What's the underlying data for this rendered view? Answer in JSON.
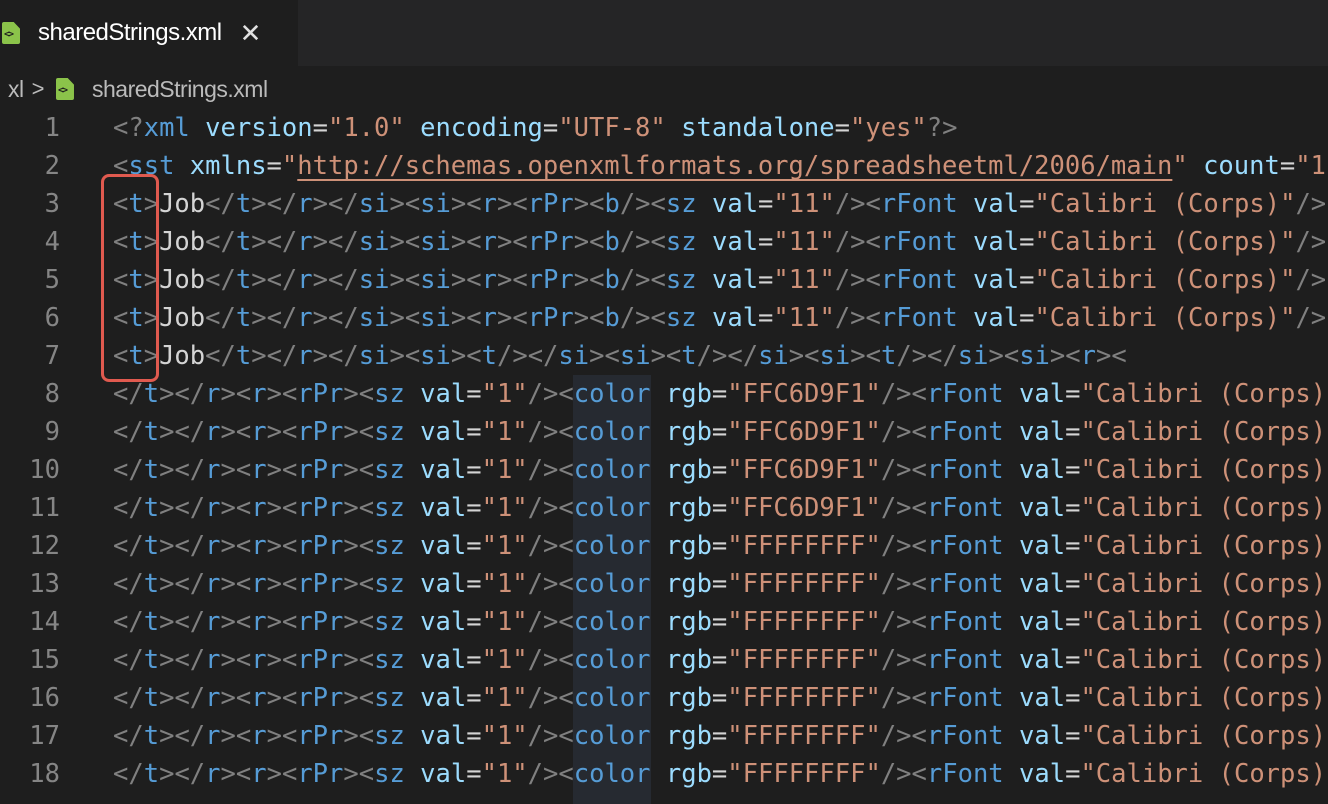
{
  "tab": {
    "label": "sharedStrings.xml",
    "close": "✕",
    "icon": "xml-file-icon",
    "icon_color": "#8bc34a"
  },
  "breadcrumb": {
    "folder": "xl",
    "separator": ">",
    "file": "sharedStrings.xml"
  },
  "highlight_color": "#e05a4f",
  "lines": [
    {
      "n": "1",
      "text": "<?xml version=\"1.0\" encoding=\"UTF-8\" standalone=\"yes\"?>"
    },
    {
      "n": "2",
      "text": "<sst xmlns=\"http://schemas.openxmlformats.org/spreadsheetml/2006/main\" count=\"1"
    },
    {
      "n": "3",
      "text": "<t>Job</t></r></si><si><r><rPr><b/><sz val=\"11\"/><rFont val=\"Calibri (Corps)\"/>"
    },
    {
      "n": "4",
      "text": "<t>Job</t></r></si><si><r><rPr><b/><sz val=\"11\"/><rFont val=\"Calibri (Corps)\"/>"
    },
    {
      "n": "5",
      "text": "<t>Job</t></r></si><si><r><rPr><b/><sz val=\"11\"/><rFont val=\"Calibri (Corps)\"/>"
    },
    {
      "n": "6",
      "text": "<t>Job</t></r></si><si><r><rPr><b/><sz val=\"11\"/><rFont val=\"Calibri (Corps)\"/>"
    },
    {
      "n": "7",
      "text": "<t>Job</t></r></si><si><t/></si><si><t/></si><si><t/></si><si><r><"
    },
    {
      "n": "8",
      "text": "</t></r><r><rPr><sz val=\"1\"/><color rgb=\"FFC6D9F1\"/><rFont val=\"Calibri (Corps)"
    },
    {
      "n": "9",
      "text": "</t></r><r><rPr><sz val=\"1\"/><color rgb=\"FFC6D9F1\"/><rFont val=\"Calibri (Corps)"
    },
    {
      "n": "10",
      "text": "</t></r><r><rPr><sz val=\"1\"/><color rgb=\"FFC6D9F1\"/><rFont val=\"Calibri (Corps)"
    },
    {
      "n": "11",
      "text": "</t></r><r><rPr><sz val=\"1\"/><color rgb=\"FFC6D9F1\"/><rFont val=\"Calibri (Corps)"
    },
    {
      "n": "12",
      "text": "</t></r><r><rPr><sz val=\"1\"/><color rgb=\"FFFFFFFF\"/><rFont val=\"Calibri (Corps)"
    },
    {
      "n": "13",
      "text": "</t></r><r><rPr><sz val=\"1\"/><color rgb=\"FFFFFFFF\"/><rFont val=\"Calibri (Corps)"
    },
    {
      "n": "14",
      "text": "</t></r><r><rPr><sz val=\"1\"/><color rgb=\"FFFFFFFF\"/><rFont val=\"Calibri (Corps)"
    },
    {
      "n": "15",
      "text": "</t></r><r><rPr><sz val=\"1\"/><color rgb=\"FFFFFFFF\"/><rFont val=\"Calibri (Corps)"
    },
    {
      "n": "16",
      "text": "</t></r><r><rPr><sz val=\"1\"/><color rgb=\"FFFFFFFF\"/><rFont val=\"Calibri (Corps)"
    },
    {
      "n": "17",
      "text": "</t></r><r><rPr><sz val=\"1\"/><color rgb=\"FFFFFFFF\"/><rFont val=\"Calibri (Corps)"
    },
    {
      "n": "18",
      "text": "</t></r><r><rPr><sz val=\"1\"/><color rgb=\"FFFFFFFF\"/><rFont val=\"Calibri (Corps)"
    }
  ]
}
